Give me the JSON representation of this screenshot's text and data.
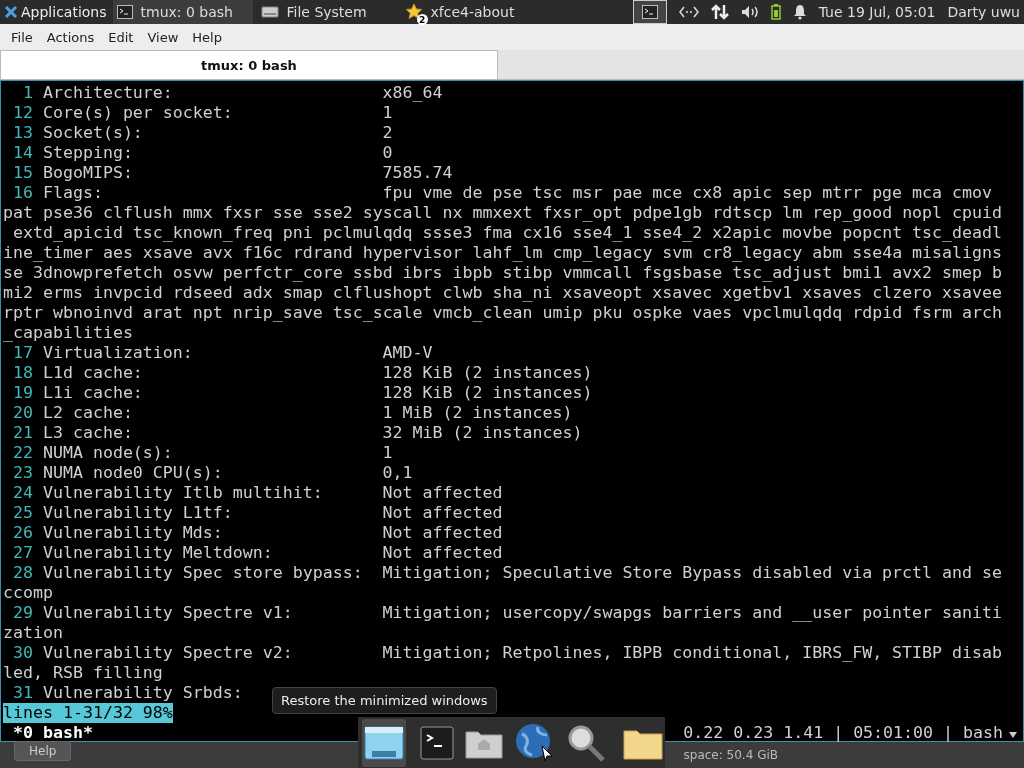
{
  "panel": {
    "app_menu": "Applications",
    "tasks": [
      {
        "label": "tmux: 0 bash",
        "selected": true
      },
      {
        "label": "File System",
        "selected": false
      },
      {
        "label": "xfce4-about",
        "selected": false,
        "badge": "2"
      }
    ],
    "clock": "Tue 19 Jul, 05:01",
    "user": "Darty uwu"
  },
  "menubar": [
    "File",
    "Actions",
    "Edit",
    "View",
    "Help"
  ],
  "tabs": [
    {
      "label": "tmux: 0 bash",
      "selected": true
    }
  ],
  "terminal": {
    "lines": [
      {
        "kind": "numbered",
        "number": "1",
        "key": "Architecture:",
        "value": "x86_64"
      },
      {
        "kind": "numbered",
        "number": "12",
        "key": "Core(s) per socket:",
        "value": "1"
      },
      {
        "kind": "numbered",
        "number": "13",
        "key": "Socket(s):",
        "value": "2"
      },
      {
        "kind": "numbered",
        "number": "14",
        "key": "Stepping:",
        "value": "0"
      },
      {
        "kind": "numbered",
        "number": "15",
        "key": "BogoMIPS:",
        "value": "7585.74"
      },
      {
        "kind": "numbered",
        "number": "16",
        "key": "Flags:",
        "value": "fpu vme de pse tsc msr pae mce cx8 apic sep mtrr pge mca cmov"
      },
      {
        "kind": "wrap",
        "text": "pat pse36 clflush mmx fxsr sse sse2 syscall nx mmxext fxsr_opt pdpe1gb rdtscp lm rep_good nopl cpuid"
      },
      {
        "kind": "wrap",
        "text": " extd_apicid tsc_known_freq pni pclmulqdq ssse3 fma cx16 sse4_1 sse4_2 x2apic movbe popcnt tsc_deadl"
      },
      {
        "kind": "wrap",
        "text": "ine_timer aes xsave avx f16c rdrand hypervisor lahf_lm cmp_legacy svm cr8_legacy abm sse4a misaligns"
      },
      {
        "kind": "wrap",
        "text": "se 3dnowprefetch osvw perfctr_core ssbd ibrs ibpb stibp vmmcall fsgsbase tsc_adjust bmi1 avx2 smep b"
      },
      {
        "kind": "wrap",
        "text": "mi2 erms invpcid rdseed adx smap clflushopt clwb sha_ni xsaveopt xsavec xgetbv1 xsaves clzero xsavee"
      },
      {
        "kind": "wrap",
        "text": "rptr wbnoinvd arat npt nrip_save tsc_scale vmcb_clean umip pku ospke vaes vpclmulqdq rdpid fsrm arch"
      },
      {
        "kind": "wrap",
        "text": "_capabilities"
      },
      {
        "kind": "numbered",
        "number": "17",
        "key": "Virtualization:",
        "value": "AMD-V"
      },
      {
        "kind": "numbered",
        "number": "18",
        "key": "L1d cache:",
        "value": "128 KiB (2 instances)"
      },
      {
        "kind": "numbered",
        "number": "19",
        "key": "L1i cache:",
        "value": "128 KiB (2 instances)"
      },
      {
        "kind": "numbered",
        "number": "20",
        "key": "L2 cache:",
        "value": "1 MiB (2 instances)"
      },
      {
        "kind": "numbered",
        "number": "21",
        "key": "L3 cache:",
        "value": "32 MiB (2 instances)"
      },
      {
        "kind": "numbered",
        "number": "22",
        "key": "NUMA node(s):",
        "value": "1"
      },
      {
        "kind": "numbered",
        "number": "23",
        "key": "NUMA node0 CPU(s):",
        "value": "0,1"
      },
      {
        "kind": "numbered",
        "number": "24",
        "key": "Vulnerability Itlb multihit:",
        "value": "Not affected"
      },
      {
        "kind": "numbered",
        "number": "25",
        "key": "Vulnerability L1tf:",
        "value": "Not affected"
      },
      {
        "kind": "numbered",
        "number": "26",
        "key": "Vulnerability Mds:",
        "value": "Not affected"
      },
      {
        "kind": "numbered",
        "number": "27",
        "key": "Vulnerability Meltdown:",
        "value": "Not affected"
      },
      {
        "kind": "numbered",
        "number": "28",
        "key": "Vulnerability Spec store bypass:",
        "value": "Mitigation; Speculative Store Bypass disabled via prctl and se"
      },
      {
        "kind": "wrap",
        "text": "ccomp"
      },
      {
        "kind": "numbered",
        "number": "29",
        "key": "Vulnerability Spectre v1:",
        "value": "Mitigation; usercopy/swapgs barriers and __user pointer saniti"
      },
      {
        "kind": "wrap",
        "text": "zation"
      },
      {
        "kind": "numbered",
        "number": "30",
        "key": "Vulnerability Spectre v2:",
        "value": "Mitigation; Retpolines, IBPB conditional, IBRS_FW, STIBP disab"
      },
      {
        "kind": "wrap",
        "text": "led, RSB filling"
      },
      {
        "kind": "numbered",
        "number": "31",
        "key": "Vulnerability Srbds:"
      }
    ],
    "position": "lines 1-31/32 98%",
    "window": "*0 bash*",
    "status_right": "0.22 0.23 1.41 | 05:01:00 | bash"
  },
  "background": {
    "button": "Help",
    "disk": "space: 50.4 GiB"
  },
  "dock": [
    {
      "kind": "desktop",
      "selected": true
    },
    {
      "kind": "terminal",
      "selected": false
    },
    {
      "kind": "home",
      "selected": false
    },
    {
      "kind": "browser",
      "selected": false
    },
    {
      "kind": "search",
      "selected": false
    },
    {
      "kind": "folder",
      "selected": false
    }
  ],
  "tooltip": "Restore the minimized windows"
}
